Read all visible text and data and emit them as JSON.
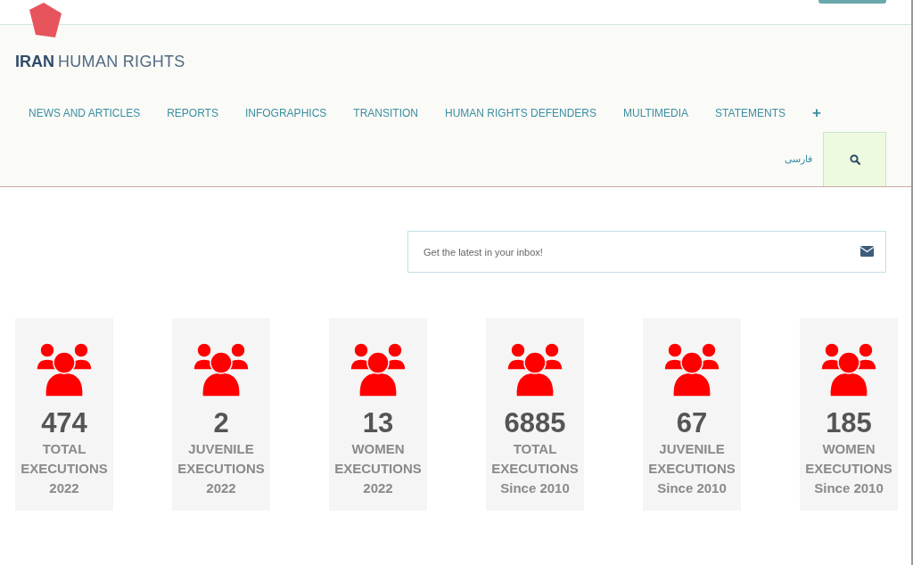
{
  "logo": {
    "bold": "IRAN",
    "light": "HUMAN RIGHTS"
  },
  "nav": [
    {
      "label": "NEWS AND ARTICLES"
    },
    {
      "label": "REPORTS"
    },
    {
      "label": "INFOGRAPHICS"
    },
    {
      "label": "TRANSITION"
    },
    {
      "label": "HUMAN RIGHTS DEFENDERS"
    },
    {
      "label": "MULTIMEDIA"
    },
    {
      "label": "STATEMENTS"
    },
    {
      "label": "+"
    }
  ],
  "language_link": "فارسی",
  "newsletter": {
    "placeholder": "Get the latest in your inbox!"
  },
  "stats": [
    {
      "number": "474",
      "label": "TOTAL EXECUTIONS 2022"
    },
    {
      "number": "2",
      "label": "JUVENILE EXECUTIONS 2022"
    },
    {
      "number": "13",
      "label": "WOMEN EXECUTIONS 2022"
    },
    {
      "number": "6885",
      "label": "TOTAL EXECUTIONS Since 2010"
    },
    {
      "number": "67",
      "label": "JUVENILE EXECUTIONS Since 2010"
    },
    {
      "number": "185",
      "label": "WOMEN EXECUTIONS Since 2010"
    }
  ]
}
